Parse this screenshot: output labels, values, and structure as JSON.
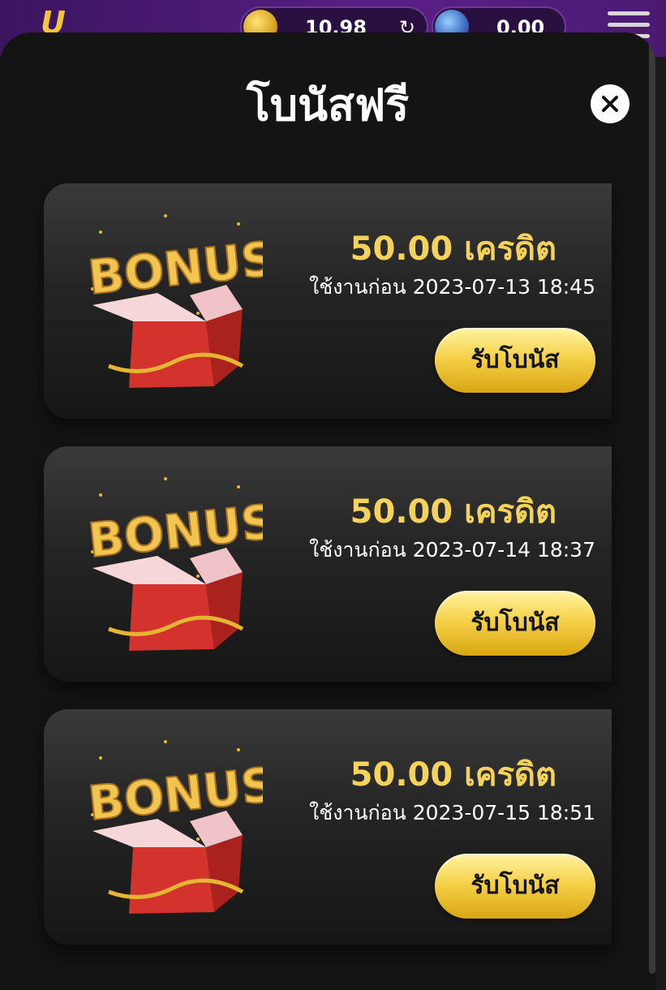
{
  "appbar": {
    "logo_text": "U",
    "credit_value": "10.98",
    "point_value": "0.00",
    "icons": [
      "coin-icon",
      "refresh-icon",
      "gem-icon",
      "menu-icon"
    ]
  },
  "modal": {
    "title": "โบนัสฟรี",
    "close_icon": "close-icon"
  },
  "colors": {
    "amount": "#f5d35a",
    "button_gold": "#f6d24a",
    "modal_bg": "#141414",
    "appbar_purple": "#5a1f86"
  },
  "bonuses": [
    {
      "amount": "50.00 เครดิต",
      "expiry": "ใช้งานก่อน 2023-07-13 18:45",
      "button_label": "รับโบนัส",
      "image_text": "BONUS"
    },
    {
      "amount": "50.00 เครดิต",
      "expiry": "ใช้งานก่อน 2023-07-14 18:37",
      "button_label": "รับโบนัส",
      "image_text": "BONUS"
    },
    {
      "amount": "50.00 เครดิต",
      "expiry": "ใช้งานก่อน 2023-07-15 18:51",
      "button_label": "รับโบนัส",
      "image_text": "BONUS"
    }
  ]
}
